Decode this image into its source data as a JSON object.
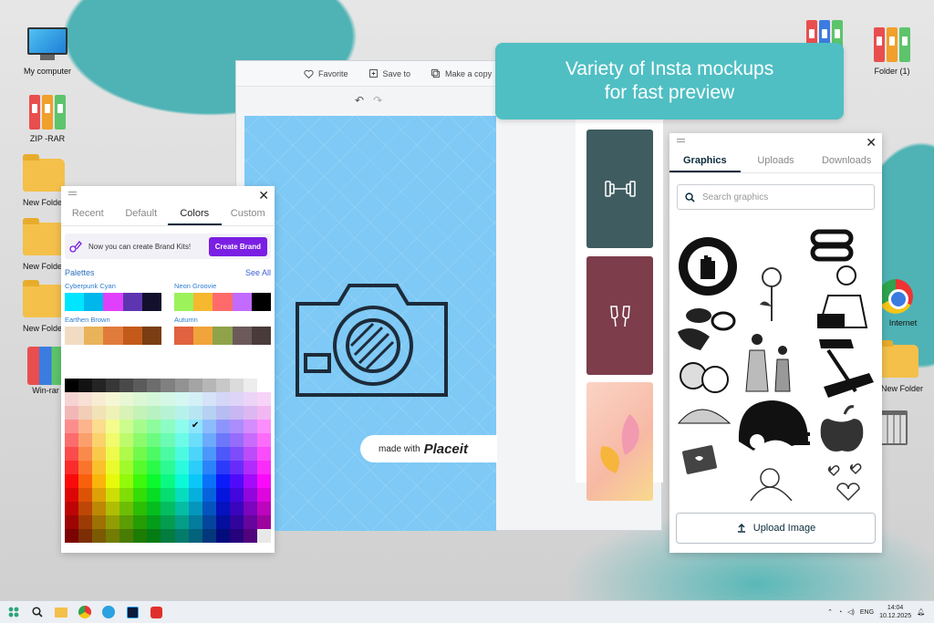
{
  "desktop": {
    "left_icons": [
      "My computer",
      "ZIP -RAR",
      "New Folder",
      "New Folder",
      "New Folder",
      "Win-rar"
    ],
    "right_icons": [
      "Folder (1)",
      "Internet",
      "New Folder"
    ]
  },
  "banner": {
    "line1": "Variety of Insta mockups",
    "line2": "for fast preview"
  },
  "editor": {
    "toolbar": {
      "favorite": "Favorite",
      "save": "Save to",
      "copy": "Make a copy"
    },
    "watermark": {
      "prefix": "made with",
      "brand": "Placeit"
    }
  },
  "colors_panel": {
    "tabs": [
      "Recent",
      "Default",
      "Colors",
      "Custom"
    ],
    "active_tab": "Colors",
    "brand_notice": "Now you can create Brand Kits!",
    "brand_button": "Create Brand",
    "palettes_label": "Palettes",
    "see_all": "See All",
    "palettes": [
      {
        "name": "Cyberpunk Cyan",
        "colors": [
          "#00e5ff",
          "#00b7eb",
          "#e040fb",
          "#5e35b1",
          "#12102c"
        ]
      },
      {
        "name": "Neon Groovie",
        "colors": [
          "#9cf25a",
          "#f5b82e",
          "#ff6b6b",
          "#c36bff",
          "#000000"
        ]
      },
      {
        "name": "Earthen Brown",
        "colors": [
          "#f1dcc3",
          "#e9b35a",
          "#e07b3c",
          "#c45a1a",
          "#7a3e12"
        ]
      },
      {
        "name": "Autumn",
        "colors": [
          "#e0623f",
          "#f0a43a",
          "#8ea34a",
          "#6c5a5a",
          "#4a3b3b"
        ]
      }
    ]
  },
  "graphics_panel": {
    "tabs": [
      "Graphics",
      "Uploads",
      "Downloads"
    ],
    "active_tab": "Graphics",
    "search_placeholder": "Search graphics",
    "upload_label": "Upload Image"
  },
  "taskbar": {
    "lang": "ENG",
    "time": "14:04",
    "date": "10.12.2025"
  },
  "colors": {
    "accent": "#7a1fe3",
    "banner": "#4fbfc3",
    "canvas": "#7ec9f5",
    "dark": "#0c2b3c"
  }
}
